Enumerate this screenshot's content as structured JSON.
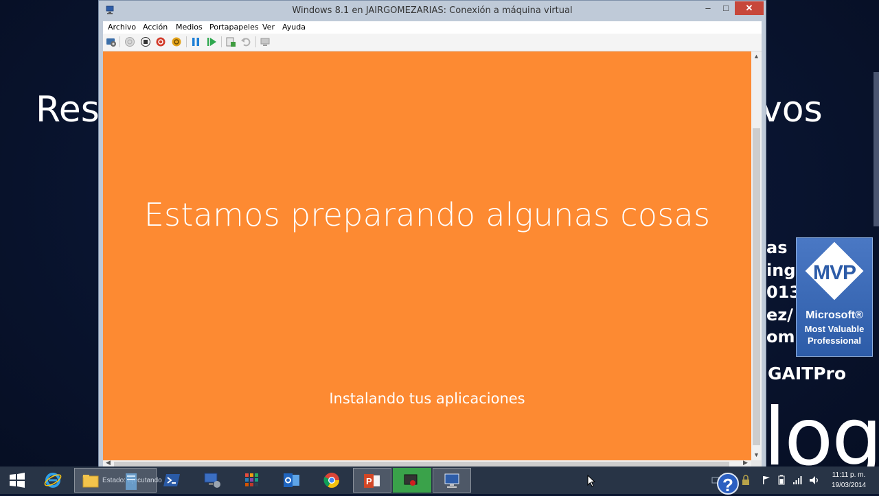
{
  "slide": {
    "title_left": "Rest",
    "title_right": "vos",
    "right_lines": [
      "as",
      "ing",
      "013",
      "ez/",
      "om"
    ],
    "handle": "GAITPro",
    "blog_fragment": "log",
    "mvp": {
      "logo_text": "MVP",
      "brand": "Microsoft®",
      "line1": "Most Valuable",
      "line2": "Professional"
    }
  },
  "window": {
    "title": "Windows 8.1 en JAIRGOMEZARIAS: Conexión a máquina virtual",
    "min_glyph": "‒",
    "max_glyph": "□",
    "close_glyph": "✕"
  },
  "menu": [
    "Archivo",
    "Acción",
    "Medios",
    "Portapapeles",
    "Ver",
    "Ayuda"
  ],
  "toolbar": {
    "buttons": [
      "ctrl-alt-del-icon",
      "start-icon",
      "turn-off-icon",
      "shutdown-icon",
      "save-icon",
      "pause-icon",
      "reset-icon",
      "snapshot-icon",
      "revert-icon",
      "enhanced-session-icon"
    ]
  },
  "guest": {
    "heading": "Estamos preparando algunas cosas",
    "status": "Instalando tus aplicaciones"
  },
  "taskbar": {
    "explorer_label": "Estado: Ejecutando",
    "clock_time": "11:11 p. m.",
    "clock_date": "19/03/2014",
    "help_glyph": "?"
  },
  "colors": {
    "guest_background": "#fd8a32",
    "close_button": "#c7473a",
    "slide_background": "#0a1530",
    "taskbar": "#283446"
  }
}
